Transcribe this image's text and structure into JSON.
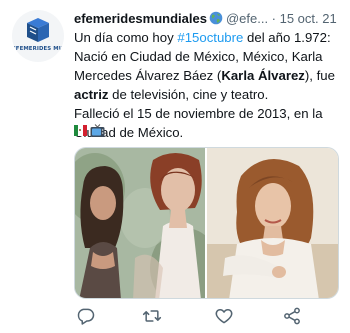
{
  "tweet": {
    "avatar_text": "EFEMERIDES MUNDIALE",
    "display_name": "efemeridesmundiales",
    "handle_time": "@efe... · 15 oct. 21",
    "body": {
      "intro": "Un día como hoy ",
      "hashtag": "#15octubre",
      "after_hashtag": " del año 1.972: Nació en Ciudad de México, México, Karla Mercedes Álvarez Báez (",
      "bold_name": "Karla Álvarez",
      "after_name": "), fue ",
      "bold_role": "actriz",
      "after_role": " de televisión, cine y teatro.",
      "line_death": "Falleció el 15 de noviembre de 2013, en la Ciudad de México."
    },
    "emojis": [
      "mexico-flag-icon",
      "television-icon"
    ]
  },
  "actions": [
    "reply-icon",
    "retweet-icon",
    "like-icon",
    "share-icon"
  ],
  "colors": {
    "hashtag": "#1d9bf0",
    "text": "#0f1419",
    "meta": "#536471",
    "icon": "#536471"
  }
}
